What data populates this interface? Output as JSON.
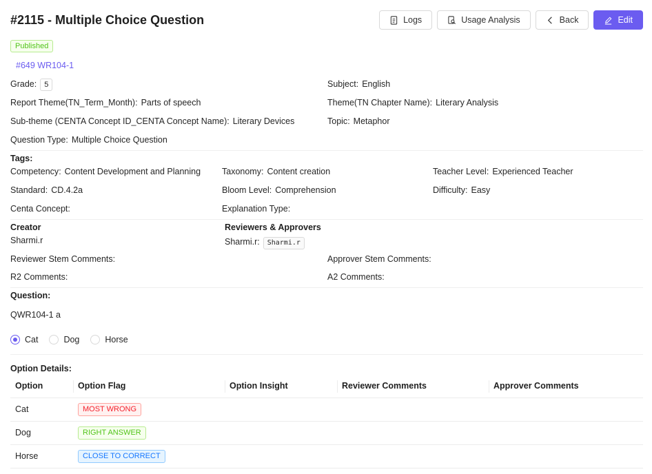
{
  "page": {
    "title": "#2115 - Multiple Choice Question",
    "status": "Published",
    "question_link": "#649 WR104-1"
  },
  "toolbar": {
    "logs": "Logs",
    "usage": "Usage Analysis",
    "back": "Back",
    "edit": "Edit"
  },
  "details": {
    "grade_label": "Grade",
    "grade_value": "5",
    "subject_label": "Subject",
    "subject_value": "English",
    "report_theme_label": "Report Theme(TN_Term_Month)",
    "report_theme_value": "Parts of speech",
    "theme_label": "Theme(TN Chapter Name)",
    "theme_value": "Literary Analysis",
    "subtheme_label": "Sub-theme (CENTA Concept ID_CENTA Concept Name)",
    "subtheme_value": "Literary Devices",
    "topic_label": "Topic",
    "topic_value": "Metaphor",
    "qtype_label": "Question Type",
    "qtype_value": "Multiple Choice Question"
  },
  "tags": {
    "heading": "Tags:",
    "competency_label": "Competency",
    "competency_value": "Content Development and Planning",
    "taxonomy_label": "Taxonomy",
    "taxonomy_value": "Content creation",
    "teacher_level_label": "Teacher Level",
    "teacher_level_value": "Experienced Teacher",
    "standard_label": "Standard",
    "standard_value": "CD.4.2a",
    "bloom_label": "Bloom Level",
    "bloom_value": "Comprehension",
    "difficulty_label": "Difficulty",
    "difficulty_value": "Easy",
    "centa_label": "Centa Concept",
    "explanation_label": "Explanation Type"
  },
  "people": {
    "creator_heading": "Creator",
    "creator_name": "Sharmi.r",
    "reviewers_heading": "Reviewers & Approvers",
    "reviewer_name": "Sharmi.r",
    "reviewer_tag": "Sharmi.r"
  },
  "comments": {
    "reviewer_stem": "Reviewer Stem Comments",
    "approver_stem": "Approver Stem Comments",
    "r2": "R2 Comments",
    "a2": "A2 Comments"
  },
  "question": {
    "heading": "Question:",
    "text": "QWR104-1 a",
    "options": [
      "Cat",
      "Dog",
      "Horse"
    ],
    "selected": "Cat"
  },
  "option_details": {
    "heading": "Option Details:",
    "columns": [
      "Option",
      "Option Flag",
      "Option Insight",
      "Reviewer Comments",
      "Approver Comments"
    ],
    "rows": [
      {
        "option": "Cat",
        "flag": "MOST WRONG",
        "flag_color": "#f5222d"
      },
      {
        "option": "Dog",
        "flag": "RIGHT ANSWER",
        "flag_color": "#52c41a"
      },
      {
        "option": "Horse",
        "flag": "CLOSE TO CORRECT",
        "flag_color": "#1677ff"
      }
    ]
  },
  "colors": {
    "accent": "#6b5cf0"
  }
}
